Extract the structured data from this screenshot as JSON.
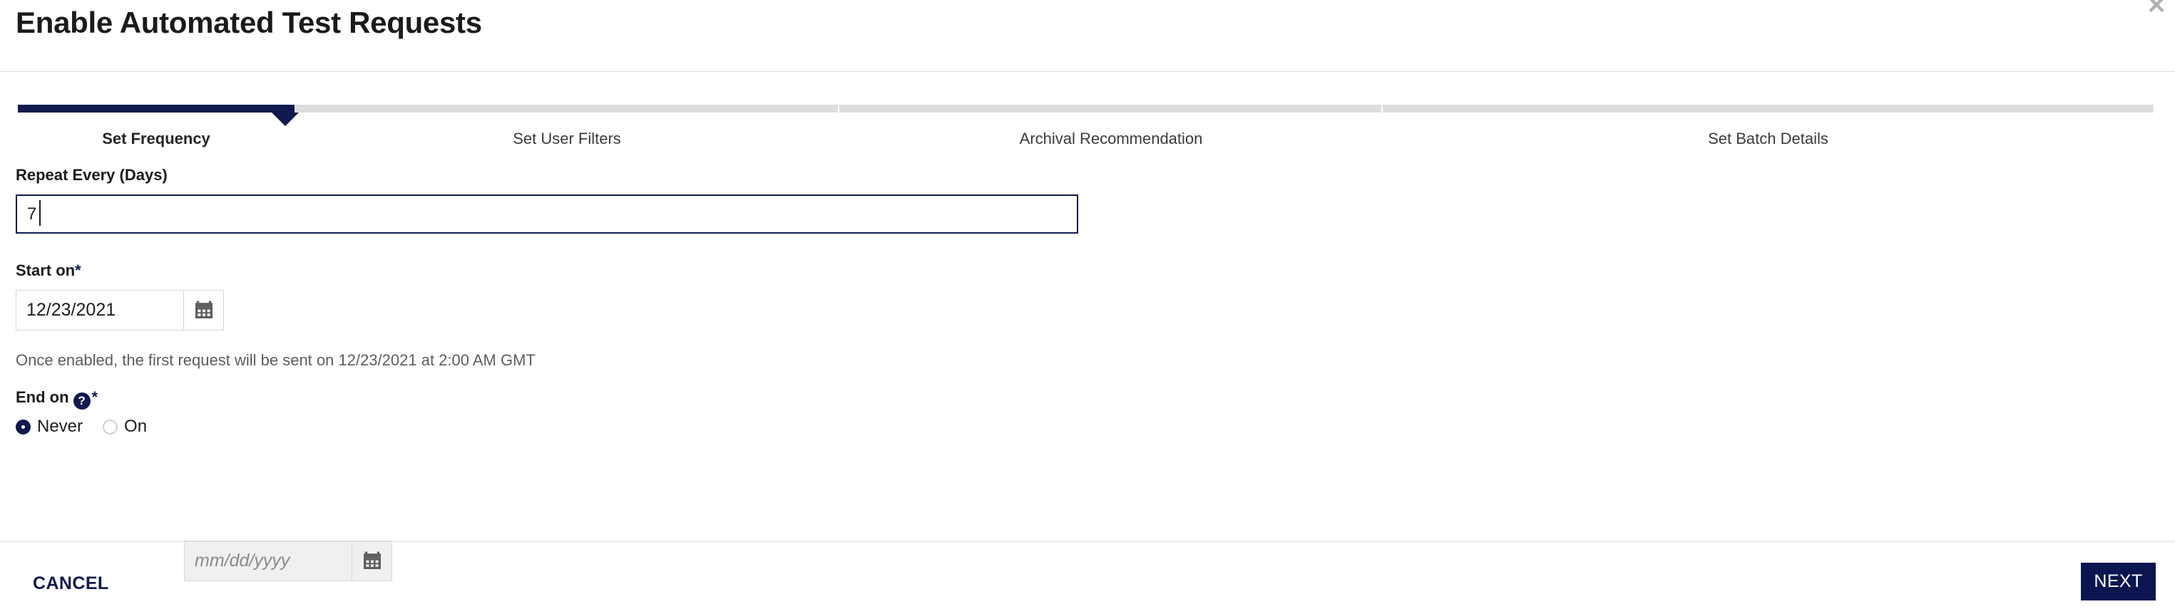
{
  "dialog": {
    "title": "Enable Automated Test Requests",
    "close_icon": "close-icon",
    "close_glyph": "✕"
  },
  "stepper": {
    "active_index": 0,
    "steps": [
      {
        "label": "Set Frequency",
        "state": "active"
      },
      {
        "label": "Set User Filters",
        "state": "upcoming"
      },
      {
        "label": "Archival Recommendation",
        "state": "upcoming"
      },
      {
        "label": "Set Batch Details",
        "state": "upcoming"
      }
    ]
  },
  "form": {
    "repeat": {
      "label": "Repeat Every (Days)",
      "value": "7",
      "focused": true
    },
    "start_on": {
      "label": "Start on",
      "required_marker": "*",
      "value": "12/23/2021",
      "calendar_icon": "calendar-icon"
    },
    "hint": "Once enabled, the first request will be sent on 12/23/2021 at 2:00 AM GMT",
    "end_on": {
      "label": "End on",
      "help_icon": "help-icon",
      "help_glyph": "?",
      "required_marker": "*",
      "options": [
        {
          "label": "Never",
          "selected": true
        },
        {
          "label": "On",
          "selected": false
        }
      ],
      "date": {
        "value": "",
        "placeholder": "mm/dd/yyyy",
        "disabled": true,
        "calendar_icon": "calendar-icon"
      }
    }
  },
  "footer": {
    "cancel_label": "CANCEL",
    "next_label": "NEXT"
  },
  "colors": {
    "brand_navy": "#101a4e",
    "next_button_bg": "#0b1550",
    "track_grey": "#dedede",
    "rule_grey": "#dcdcdc",
    "disabled_bg": "#f0f0f0"
  }
}
